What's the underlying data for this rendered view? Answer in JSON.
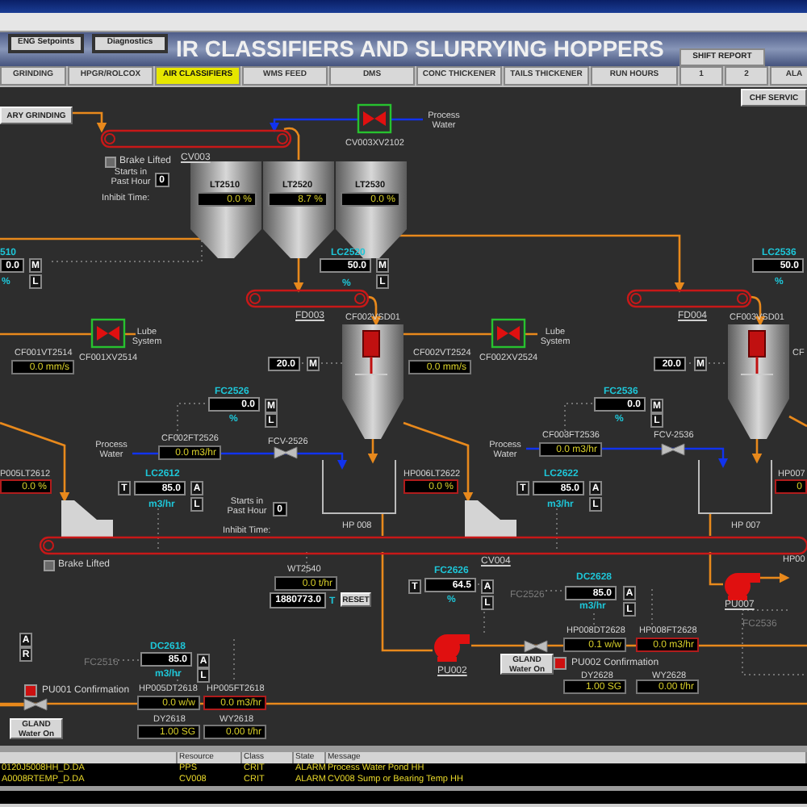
{
  "header": {
    "buttons": [
      "ENG Setpoints",
      "Diagnostics"
    ],
    "title": "IR CLASSIFIERS AND SLURRYING HOPPERS",
    "shift_report": "SHIFT REPORT"
  },
  "tabs": [
    {
      "label": "GRINDING",
      "selected": false
    },
    {
      "label": "HPGR/ROLCOX",
      "selected": false
    },
    {
      "label": "AIR CLASSIFIERS",
      "selected": true
    },
    {
      "label": "WMS FEED",
      "selected": false
    },
    {
      "label": "DMS",
      "selected": false
    },
    {
      "label": "CONC THICKENER",
      "selected": false
    },
    {
      "label": "TAILS THICKENER",
      "selected": false
    },
    {
      "label": "RUN HOURS",
      "selected": false
    },
    {
      "label": "1",
      "selected": false
    },
    {
      "label": "2",
      "selected": false
    },
    {
      "label": "ALA",
      "selected": false
    }
  ],
  "elements": [
    {
      "kind": "button",
      "text": "CHF SERVIC"
    },
    {
      "kind": "button",
      "text": "ARY GRINDING"
    },
    {
      "kind": "underlined",
      "text": "CV003"
    },
    {
      "kind": "check",
      "text": "Brake Lifted",
      "checked": false
    },
    {
      "kind": "label",
      "text": "Starts in Past Hour"
    },
    {
      "kind": "setpoint",
      "text": "0"
    },
    {
      "kind": "label",
      "text": "Inhibit Time:"
    },
    {
      "kind": "label",
      "text": "CV003XV2102"
    },
    {
      "kind": "label",
      "text": "Process Water"
    },
    {
      "kind": "label",
      "text": "LT2510"
    },
    {
      "kind": "readout",
      "text": "0.0 %"
    },
    {
      "kind": "label",
      "text": "LT2520"
    },
    {
      "kind": "readout",
      "text": "8.7 %"
    },
    {
      "kind": "label",
      "text": "LT2530"
    },
    {
      "kind": "readout",
      "text": "0.0 %"
    },
    {
      "kind": "tag",
      "text": "510"
    },
    {
      "kind": "setpoint",
      "text": "0.0"
    },
    {
      "kind": "key",
      "text": "M"
    },
    {
      "kind": "tag",
      "text": "%"
    },
    {
      "kind": "key",
      "text": "L"
    },
    {
      "kind": "tag",
      "text": "LC2520"
    },
    {
      "kind": "setpoint",
      "text": "50.0"
    },
    {
      "kind": "key",
      "text": "M"
    },
    {
      "kind": "tag",
      "text": "%"
    },
    {
      "kind": "key",
      "text": "L"
    },
    {
      "kind": "underlined",
      "text": "FD003"
    },
    {
      "kind": "label",
      "text": "CF002VSD01"
    },
    {
      "kind": "label",
      "text": "Lube System"
    },
    {
      "kind": "label",
      "text": "CF001XV2514"
    },
    {
      "kind": "label",
      "text": "CF001VT2514"
    },
    {
      "kind": "readout",
      "text": "0.0 mm/s"
    },
    {
      "kind": "setpoint",
      "text": "20.0"
    },
    {
      "kind": "key",
      "text": "M"
    },
    {
      "kind": "tag",
      "text": "FC2526"
    },
    {
      "kind": "setpoint",
      "text": "0.0"
    },
    {
      "kind": "key",
      "text": "M"
    },
    {
      "kind": "tag",
      "text": "%"
    },
    {
      "kind": "key",
      "text": "L"
    },
    {
      "kind": "label",
      "text": "CF002FT2526"
    },
    {
      "kind": "label",
      "text": "Process Water"
    },
    {
      "kind": "readout",
      "text": "0.0 m3/hr"
    },
    {
      "kind": "label",
      "text": "FCV-2526"
    },
    {
      "kind": "label",
      "text": "P005LT2612"
    },
    {
      "kind": "alarm",
      "text": "0.0 %"
    },
    {
      "kind": "key",
      "text": "T"
    },
    {
      "kind": "tag",
      "text": "LC2612"
    },
    {
      "kind": "setpoint",
      "text": "85.0"
    },
    {
      "kind": "key",
      "text": "A"
    },
    {
      "kind": "tag",
      "text": "m3/hr"
    },
    {
      "kind": "key",
      "text": "L"
    },
    {
      "kind": "label",
      "text": "Starts in Past Hour"
    },
    {
      "kind": "setpoint",
      "text": "0"
    },
    {
      "kind": "label",
      "text": "Inhibit Time:"
    },
    {
      "kind": "label",
      "text": "HP 008"
    },
    {
      "kind": "label",
      "text": "HP006LT2622"
    },
    {
      "kind": "alarm",
      "text": "0.0 %"
    },
    {
      "kind": "key",
      "text": "T"
    },
    {
      "kind": "tag",
      "text": "LC2622"
    },
    {
      "kind": "setpoint",
      "text": "85.0"
    },
    {
      "kind": "key",
      "text": "A"
    },
    {
      "kind": "tag",
      "text": "m3/hr"
    },
    {
      "kind": "key",
      "text": "L"
    },
    {
      "kind": "label",
      "text": "CF002VT2524"
    },
    {
      "kind": "readout",
      "text": "0.0 mm/s"
    },
    {
      "kind": "label",
      "text": "Lube System"
    },
    {
      "kind": "label",
      "text": "CF002XV2524"
    },
    {
      "kind": "underlined",
      "text": "FD004"
    },
    {
      "kind": "tag",
      "text": "LC2536"
    },
    {
      "kind": "setpoint",
      "text": "50.0"
    },
    {
      "kind": "tag",
      "text": "%"
    },
    {
      "kind": "label",
      "text": "CF003VSD01"
    },
    {
      "kind": "setpoint",
      "text": "20.0"
    },
    {
      "kind": "key",
      "text": "M"
    },
    {
      "kind": "label",
      "text": "CF"
    },
    {
      "kind": "tag",
      "text": "FC2536"
    },
    {
      "kind": "setpoint",
      "text": "0.0"
    },
    {
      "kind": "key",
      "text": "M"
    },
    {
      "kind": "tag",
      "text": "%"
    },
    {
      "kind": "key",
      "text": "L"
    },
    {
      "kind": "label",
      "text": "CF003FT2536"
    },
    {
      "kind": "label",
      "text": "Process Water"
    },
    {
      "kind": "readout",
      "text": "0.0 m3/hr"
    },
    {
      "kind": "label",
      "text": "FCV-2536"
    },
    {
      "kind": "label",
      "text": "HP 007"
    },
    {
      "kind": "label",
      "text": "HP007"
    },
    {
      "kind": "alarm",
      "text": "0"
    },
    {
      "kind": "check",
      "text": "Brake Lifted",
      "checked": false
    },
    {
      "kind": "underlined",
      "text": "CV004"
    },
    {
      "kind": "label",
      "text": "WT2540"
    },
    {
      "kind": "readout",
      "text": "0.0 t/hr"
    },
    {
      "kind": "setpoint",
      "text": "1880773.0"
    },
    {
      "kind": "tag",
      "text": "T"
    },
    {
      "kind": "button",
      "text": "RESET"
    },
    {
      "kind": "tag",
      "text": "DC2618"
    },
    {
      "kind": "faint",
      "text": "FC2516"
    },
    {
      "kind": "setpoint",
      "text": "85.0"
    },
    {
      "kind": "key",
      "text": "A"
    },
    {
      "kind": "tag",
      "text": "m3/hr"
    },
    {
      "kind": "key",
      "text": "L"
    },
    {
      "kind": "confirm",
      "text": "PU001 Confirmation"
    },
    {
      "kind": "label",
      "text": "HP005DT2618"
    },
    {
      "kind": "label",
      "text": "HP005FT2618"
    },
    {
      "kind": "readout",
      "text": "0.0 w/w"
    },
    {
      "kind": "alarm",
      "text": "0.0 m3/hr"
    },
    {
      "kind": "button",
      "text": "GLAND Water On"
    },
    {
      "kind": "label",
      "text": "DY2618"
    },
    {
      "kind": "label",
      "text": "WY2618"
    },
    {
      "kind": "readout",
      "text": "1.00 SG"
    },
    {
      "kind": "readout",
      "text": "0.00 t/hr"
    },
    {
      "kind": "key",
      "text": "A"
    },
    {
      "kind": "key",
      "text": "R"
    },
    {
      "kind": "tag",
      "text": "FC2626"
    },
    {
      "kind": "key",
      "text": "T"
    },
    {
      "kind": "setpoint",
      "text": "64.5"
    },
    {
      "kind": "key",
      "text": "A"
    },
    {
      "kind": "tag",
      "text": "%"
    },
    {
      "kind": "key",
      "text": "L"
    },
    {
      "kind": "tag",
      "text": "DC2628"
    },
    {
      "kind": "faint",
      "text": "FC2526"
    },
    {
      "kind": "setpoint",
      "text": "85.0"
    },
    {
      "kind": "key",
      "text": "A"
    },
    {
      "kind": "tag",
      "text": "m3/hr"
    },
    {
      "kind": "key",
      "text": "L"
    },
    {
      "kind": "underlined",
      "text": "PU002"
    },
    {
      "kind": "label",
      "text": "HP008DT2628"
    },
    {
      "kind": "label",
      "text": "HP008FT2628"
    },
    {
      "kind": "readout",
      "text": "0.1 w/w"
    },
    {
      "kind": "alarm",
      "text": "0.0 m3/hr"
    },
    {
      "kind": "button",
      "text": "GLAND Water On"
    },
    {
      "kind": "confirm",
      "text": "PU002 Confirmation"
    },
    {
      "kind": "label",
      "text": "DY2628"
    },
    {
      "kind": "label",
      "text": "WY2628"
    },
    {
      "kind": "readout",
      "text": "1.00 SG"
    },
    {
      "kind": "readout",
      "text": "0.00 t/hr"
    },
    {
      "kind": "underlined",
      "text": "PU007"
    },
    {
      "kind": "label",
      "text": "HP00"
    },
    {
      "kind": "faint",
      "text": "FC2536"
    }
  ],
  "alarms": {
    "columns": [
      "",
      "Resource",
      "Class",
      "State",
      "Message"
    ],
    "rows": [
      {
        "cells": [
          "0120J5008HH_D.DA",
          "PPS",
          "CRIT",
          "ALARM",
          "Process Water Pond HH"
        ]
      },
      {
        "cells": [
          "A0008RTEMP_D.DA",
          "CV008",
          "CRIT",
          "ALARM",
          "CV008 Sump or Bearing Temp HH"
        ]
      }
    ]
  }
}
